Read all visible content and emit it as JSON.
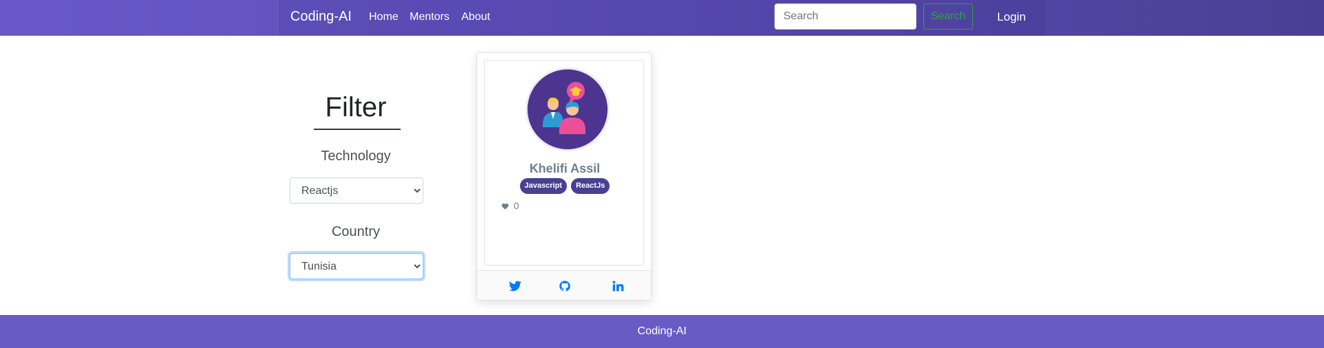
{
  "navbar": {
    "brand": "Coding-AI",
    "links": [
      "Home",
      "Mentors",
      "About"
    ],
    "search_placeholder": "Search",
    "search_button": "Search",
    "login": "Login",
    "colors": {
      "gradient_start": "#6a58c9",
      "gradient_end": "#4a3f94"
    }
  },
  "filter": {
    "title": "Filter",
    "technology_label": "Technology",
    "technology_value": "Reactjs",
    "country_label": "Country",
    "country_value": "Tunisia"
  },
  "mentor_card": {
    "avatar_icon": "mentor-avatar-icon",
    "name": "Khelifi Assil",
    "technologies": [
      "Javascript",
      "ReactJs"
    ],
    "likes_icon": "heart-icon",
    "likes": "0",
    "socials": [
      "twitter-icon",
      "github-icon",
      "linkedin-icon"
    ],
    "badge_color": "#4a3f94",
    "social_color": "#007bff"
  },
  "footer": {
    "text": "Coding-AI",
    "color": "#6a5bc4"
  }
}
